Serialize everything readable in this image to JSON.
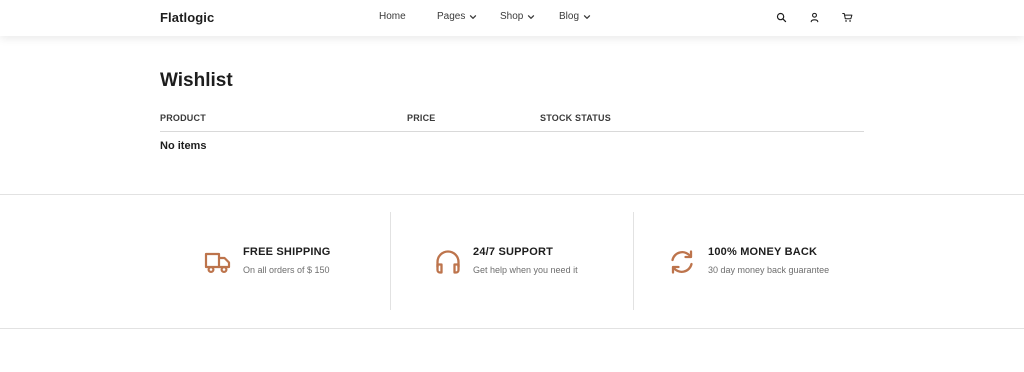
{
  "header": {
    "logo": "Flatlogic",
    "nav": [
      {
        "label": "Home",
        "icon": null
      },
      {
        "label": "Pages",
        "icon": "chevron-down-icon"
      },
      {
        "label": "Shop",
        "icon": "chevron-down-icon"
      },
      {
        "label": "Blog",
        "icon": "chevron-down-icon"
      }
    ],
    "icons": [
      "search-icon",
      "user-icon",
      "cart-icon"
    ]
  },
  "wishlist": {
    "title": "Wishlist",
    "columns": [
      "PRODUCT",
      "PRICE",
      "STOCK STATUS"
    ],
    "empty_message": "No items"
  },
  "features": [
    {
      "icon": "truck-icon",
      "title": "FREE SHIPPING",
      "subtitle": "On all orders of $ 150"
    },
    {
      "icon": "headphones-icon",
      "title": "24/7 SUPPORT",
      "subtitle": "Get help when you need it"
    },
    {
      "icon": "refresh-icon",
      "title": "100% MONEY BACK",
      "subtitle": "30 day money back guarantee"
    }
  ],
  "colors": {
    "accent": "#bd744c",
    "text": "#1d1d1d",
    "muted": "#6e6e6e",
    "divider": "#e2e2e2"
  }
}
